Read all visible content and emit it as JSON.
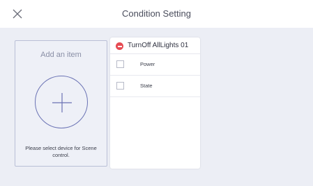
{
  "header": {
    "title": "Condition Setting",
    "close_icon": "close-icon"
  },
  "add_panel": {
    "label": "Add an item",
    "plus_icon": "plus-icon",
    "hint": "Please select device for Scene control."
  },
  "scene_card": {
    "name": "TurnOff AllLights 01",
    "remove_icon": "remove-icon",
    "items": [
      {
        "label": "Power",
        "checked": false
      },
      {
        "label": "State",
        "checked": false
      }
    ]
  },
  "colors": {
    "content_bg": "#eceef5",
    "accent": "#6a72b4",
    "remove": "#e64b53"
  }
}
